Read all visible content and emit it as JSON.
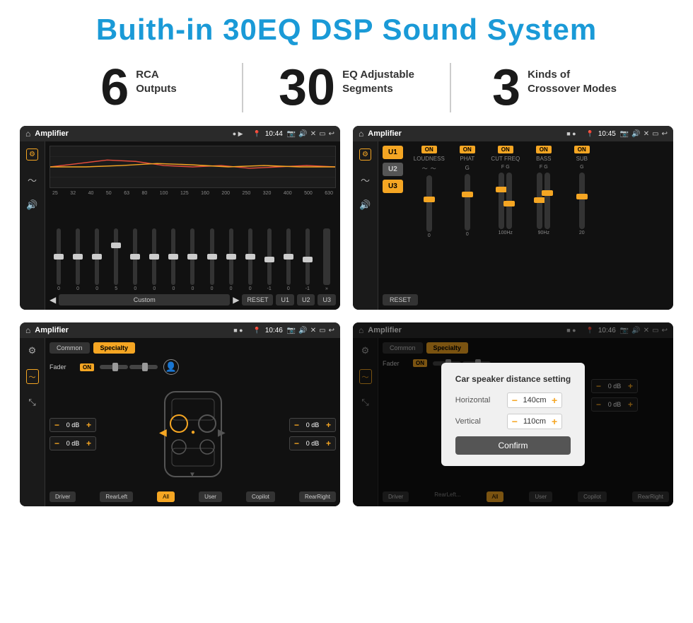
{
  "page": {
    "title": "Buith-in 30EQ DSP Sound System",
    "stats": [
      {
        "number": "6",
        "text": "RCA\nOutputs"
      },
      {
        "number": "30",
        "text": "EQ Adjustable\nSegments"
      },
      {
        "number": "3",
        "text": "Kinds of\nCrossover Modes"
      }
    ],
    "screens": [
      {
        "id": "screen1",
        "time": "10:44",
        "title": "Amplifier",
        "type": "eq",
        "freqs": [
          "25",
          "32",
          "40",
          "50",
          "63",
          "80",
          "100",
          "125",
          "160",
          "200",
          "250",
          "320",
          "400",
          "500",
          "630"
        ],
        "values": [
          "0",
          "0",
          "0",
          "5",
          "0",
          "0",
          "0",
          "0",
          "0",
          "0",
          "0",
          "-1",
          "0",
          "-1"
        ],
        "preset": "Custom",
        "buttons": [
          "RESET",
          "U1",
          "U2",
          "U3"
        ]
      },
      {
        "id": "screen2",
        "time": "10:45",
        "title": "Amplifier",
        "type": "crossover",
        "tabs": [
          "U1",
          "U2",
          "U3"
        ],
        "controls": [
          {
            "label": "LOUDNESS",
            "on": true
          },
          {
            "label": "PHAT",
            "on": true
          },
          {
            "label": "CUT FREQ",
            "on": true
          },
          {
            "label": "BASS",
            "on": true
          },
          {
            "label": "SUB",
            "on": true
          }
        ]
      },
      {
        "id": "screen3",
        "time": "10:46",
        "title": "Amplifier",
        "type": "fader",
        "tabs": [
          "Common",
          "Specialty"
        ],
        "faderLabel": "Fader",
        "faderOn": "ON",
        "dbValues": [
          "0 dB",
          "0 dB",
          "0 dB",
          "0 dB"
        ],
        "bottomBtns": [
          "Driver",
          "RearLeft",
          "All",
          "User",
          "Copilot",
          "RearRight"
        ]
      },
      {
        "id": "screen4",
        "time": "10:46",
        "title": "Amplifier",
        "type": "fader-dialog",
        "tabs": [
          "Common",
          "Specialty"
        ],
        "dialog": {
          "title": "Car speaker distance setting",
          "rows": [
            {
              "label": "Horizontal",
              "value": "140cm"
            },
            {
              "label": "Vertical",
              "value": "110cm"
            }
          ],
          "confirm": "Confirm"
        },
        "dbValues": [
          "0 dB",
          "0 dB"
        ],
        "bottomBtns": [
          "Driver",
          "RearLeft",
          "All",
          "User",
          "Copilot",
          "RearRight"
        ]
      }
    ]
  }
}
